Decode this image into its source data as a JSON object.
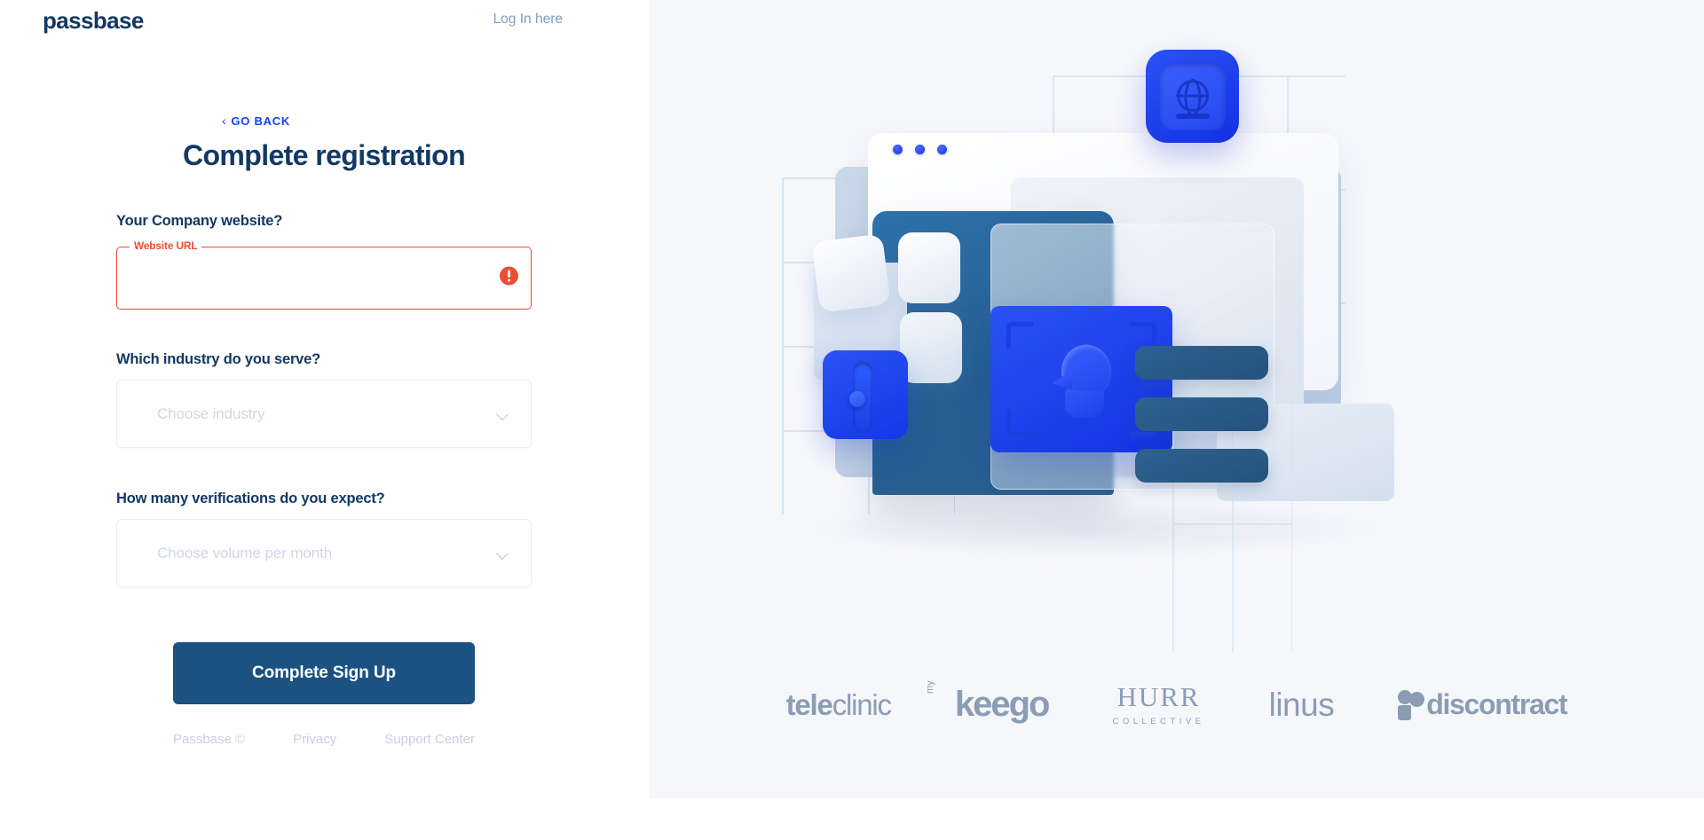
{
  "brand": {
    "name": "passbase"
  },
  "header": {
    "login_link": "Log In here"
  },
  "form": {
    "go_back": "GO BACK",
    "title": "Complete registration",
    "website": {
      "question": "Your Company website?",
      "label": "Website URL",
      "value": "",
      "placeholder": "",
      "error_state": true,
      "error_color": "#ef4a35"
    },
    "industry": {
      "question": "Which industry do you serve?",
      "placeholder": "Choose industry",
      "value": ""
    },
    "volume": {
      "question": "How many verifications do you expect?",
      "placeholder": "Choose volume per month",
      "value": ""
    },
    "submit_label": "Complete Sign Up"
  },
  "footer": {
    "links": [
      {
        "label": "Passbase ©"
      },
      {
        "label": "Privacy"
      },
      {
        "label": "Support Center"
      }
    ]
  },
  "logos": {
    "teleclinic": {
      "bold": "tele",
      "regular": "clinic"
    },
    "keego": {
      "sup": "my",
      "word": "keego"
    },
    "hurr": {
      "main": "HURR",
      "sub": "COLLECTIVE"
    },
    "linus": {
      "word": "linus"
    },
    "discontract": {
      "word": "discontract"
    }
  },
  "colors": {
    "brand_navy": "#113963",
    "accent_blue": "#1144ee",
    "button_blue": "#1b5282",
    "error_red": "#ef4a35",
    "panel_bg": "#f6f7fb",
    "muted": "#c6cfe0"
  }
}
